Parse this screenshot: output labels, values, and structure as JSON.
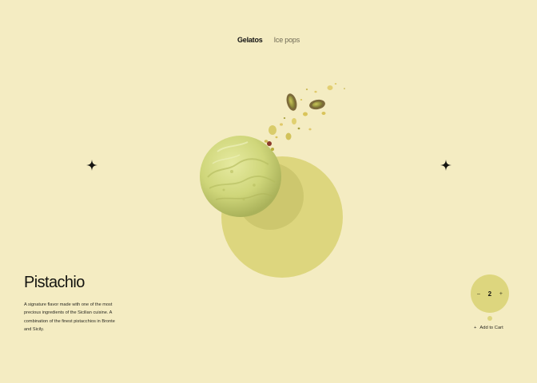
{
  "nav": {
    "tabs": [
      {
        "label": "Gelatos",
        "active": true
      },
      {
        "label": "Ice pops",
        "active": false
      }
    ]
  },
  "product": {
    "name": "Pistachio",
    "description": "A signature flavor made with one of the most precious ingredients of the Sicilian cuisine. A combination of the finest pistacchios in Bronte and Sicily."
  },
  "cart": {
    "decrement": "–",
    "quantity": "2",
    "increment": "+",
    "add_icon": "+",
    "add_label": "Add to Cart"
  },
  "colors": {
    "background": "#f4ecc2",
    "accent_circle": "#ddd67e",
    "scoop": "#d8dd88",
    "text": "#141410"
  },
  "icons": {
    "left_decoration": "sparkle-icon",
    "right_decoration": "sparkle-icon"
  }
}
